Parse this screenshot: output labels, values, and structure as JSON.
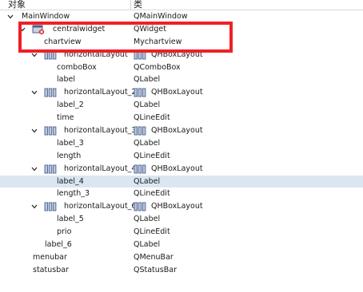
{
  "header": {
    "col_object": "对象",
    "col_class": "类"
  },
  "rows": [
    {
      "name": "MainWindow",
      "class": "QMainWindow",
      "expander": "expanded"
    },
    {
      "name": "centralwidget",
      "class": "QWidget",
      "expander": "expanded",
      "icon": "widget-icon"
    },
    {
      "name": "chartview",
      "class": "Mychartview"
    },
    {
      "name": "horizontalLayout",
      "class": "QHBoxLayout",
      "expander": "expanded",
      "icon": "hbox-layout-icon"
    },
    {
      "name": "comboBox",
      "class": "QComboBox"
    },
    {
      "name": "label",
      "class": "QLabel"
    },
    {
      "name": "horizontalLayout_2",
      "class": "QHBoxLayout",
      "expander": "expanded",
      "icon": "hbox-layout-icon"
    },
    {
      "name": "label_2",
      "class": "QLabel"
    },
    {
      "name": "time",
      "class": "QLineEdit"
    },
    {
      "name": "horizontalLayout_3",
      "class": "QHBoxLayout",
      "expander": "expanded",
      "icon": "hbox-layout-icon"
    },
    {
      "name": "label_3",
      "class": "QLabel"
    },
    {
      "name": "length",
      "class": "QLineEdit"
    },
    {
      "name": "horizontalLayout_4",
      "class": "QHBoxLayout",
      "expander": "expanded",
      "icon": "hbox-layout-icon"
    },
    {
      "name": "label_4",
      "class": "QLabel",
      "selected": true
    },
    {
      "name": "length_3",
      "class": "QLineEdit"
    },
    {
      "name": "horizontalLayout_6",
      "class": "QHBoxLayout",
      "expander": "expanded",
      "icon": "hbox-layout-icon"
    },
    {
      "name": "label_5",
      "class": "QLabel"
    },
    {
      "name": "prio",
      "class": "QLineEdit"
    },
    {
      "name": "label_6",
      "class": "QLabel"
    },
    {
      "name": "menubar",
      "class": "QMenuBar"
    },
    {
      "name": "statusbar",
      "class": "QStatusBar"
    }
  ],
  "colors": {
    "selected_row": "#dae6f2",
    "highlight_box": "#ee2027",
    "layout_icon": "#5a6e96"
  }
}
